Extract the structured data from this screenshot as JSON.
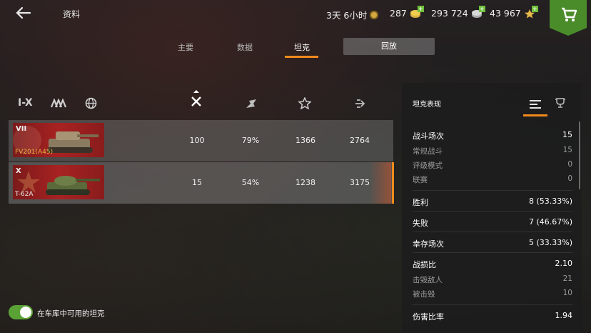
{
  "header": {
    "title": "资料",
    "timer": "3天 6小时",
    "gold": "287",
    "credits": "293 724",
    "free_xp": "43 967"
  },
  "tabs": [
    {
      "label": "主要",
      "active": false
    },
    {
      "label": "数据",
      "active": false
    },
    {
      "label": "坦克",
      "active": true
    }
  ],
  "replay_label": "回放",
  "filters": {
    "tier_filter": "I-X"
  },
  "columns": [
    "battles-icon",
    "winrate-icon",
    "mastery-icon",
    "damage-icon"
  ],
  "tanks": [
    {
      "tier": "VII",
      "name": "FV201(A45)",
      "name_color": "#e8b040",
      "battles": "100",
      "winrate": "79%",
      "col3": "1366",
      "col4": "2764",
      "selected": false
    },
    {
      "tier": "X",
      "name": "T-62A",
      "name_color": "#e8e8e8",
      "battles": "15",
      "winrate": "54%",
      "col3": "1238",
      "col4": "3175",
      "selected": true
    }
  ],
  "panel": {
    "title": "坦克表现",
    "stats": [
      {
        "label": "战斗场次",
        "value": "15",
        "kind": "main"
      },
      {
        "label": "常规战斗",
        "value": "15",
        "kind": "sub"
      },
      {
        "label": "评级模式",
        "value": "0",
        "kind": "sub"
      },
      {
        "label": "联赛",
        "value": "0",
        "kind": "sub"
      },
      {
        "label": "胜利",
        "value": "8 (53.33%)",
        "kind": "main"
      },
      {
        "label": "失败",
        "value": "7 (46.67%)",
        "kind": "main"
      },
      {
        "label": "幸存场次",
        "value": "5 (33.33%)",
        "kind": "main"
      },
      {
        "label": "战损比",
        "value": "2.10",
        "kind": "main"
      },
      {
        "label": "击毁敌人",
        "value": "21",
        "kind": "sub"
      },
      {
        "label": "被击毁",
        "value": "10",
        "kind": "sub"
      },
      {
        "label": "伤害比率",
        "value": "1.94",
        "kind": "main"
      }
    ]
  },
  "toggle": {
    "label": "在车库中可用的坦克",
    "on": true
  },
  "colors": {
    "accent": "#f08a1c",
    "shop": "#4a8c2a",
    "toggle": "#5aa235"
  }
}
